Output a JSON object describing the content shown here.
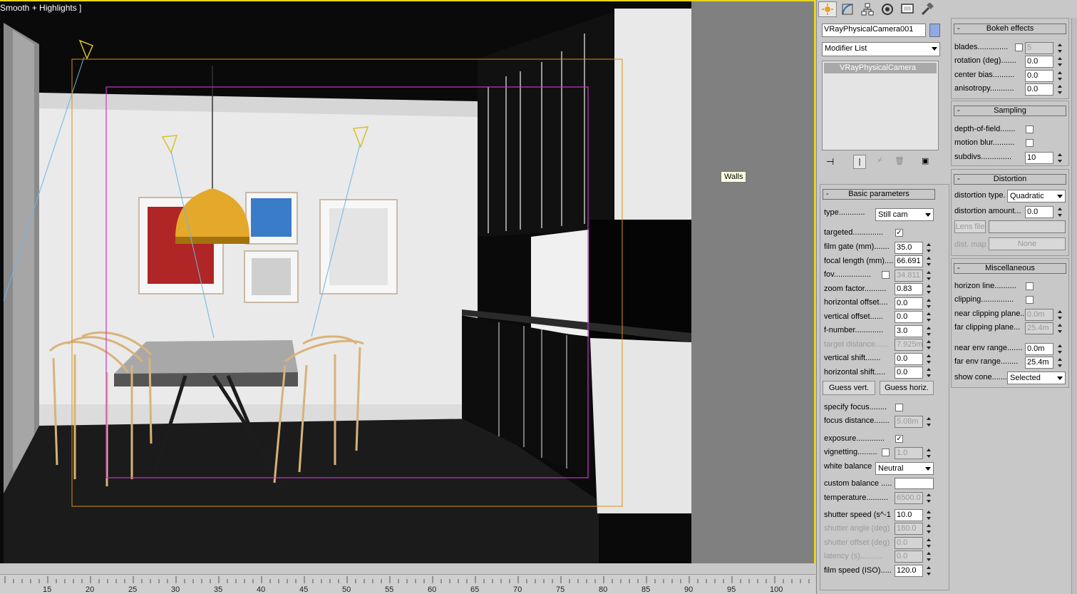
{
  "viewport": {
    "label": "Smooth + Highlights ]",
    "tooltip": "Walls"
  },
  "ruler": {
    "ticks": [
      "15",
      "20",
      "25",
      "30",
      "35",
      "40",
      "45",
      "50",
      "55",
      "60",
      "65",
      "70",
      "75",
      "80",
      "85",
      "90",
      "95",
      "100"
    ]
  },
  "command_panel": {
    "tabs": [
      "create-icon",
      "modify-icon",
      "hierarchy-icon",
      "motion-icon",
      "display-icon",
      "utilities-icon"
    ],
    "object_name": "VRayPhysicalCamera001",
    "object_color": "#8fa8e6",
    "modifier_list": "Modifier List",
    "stack_item": "VRayPhysicalCamera"
  },
  "basic": {
    "title": "Basic parameters",
    "type_label": "type............",
    "type_value": "Still cam",
    "targeted": "targeted..............",
    "film_gate": "film gate (mm).......",
    "film_gate_v": "35.0",
    "focal_length": "focal length (mm)....",
    "focal_length_v": "66.691",
    "fov": "fov.................",
    "fov_v": "34.811",
    "zoom": "zoom factor..........",
    "zoom_v": "0.83",
    "hoff": "horizontal offset....",
    "hoff_v": "0.0",
    "voff": "vertical offset......",
    "voff_v": "0.0",
    "fnum": "f-number.............",
    "fnum_v": "3.0",
    "tdist": "target distance......",
    "tdist_v": "7.925m",
    "vshift": "vertical shift.......",
    "vshift_v": "0.0",
    "hshift": "horizontal shift.....",
    "hshift_v": "0.0",
    "guess_vert": "Guess vert.",
    "guess_horiz": "Guess horiz.",
    "spec_focus": "specify focus........",
    "focus_dist": "focus distance.......",
    "focus_dist_v": "5.08m",
    "exposure": "exposure.............",
    "vignetting": "vignetting.........",
    "vignetting_v": "1.0",
    "wb": "white balance",
    "wb_v": "Neutral",
    "custom_bal": "custom balance .....",
    "temperature": "temperature..........",
    "temperature_v": "6500.0",
    "shutter": "shutter speed (s^-1",
    "shutter_v": "10.0",
    "shutter_angle": "shutter angle (deg)",
    "shutter_angle_v": "180.0",
    "shutter_offset": "shutter offset (deg)",
    "shutter_offset_v": "0.0",
    "latency": "latency (s)..........",
    "latency_v": "0.0",
    "iso": "film speed (ISO).....",
    "iso_v": "120.0"
  },
  "bokeh": {
    "title": "Bokeh effects",
    "blades": "blades..............",
    "blades_v": "5",
    "rotation": "rotation (deg).......",
    "rotation_v": "0.0",
    "center_bias": "center bias..........",
    "center_bias_v": "0.0",
    "anisotropy": "anisotropy...........",
    "anisotropy_v": "0.0"
  },
  "sampling": {
    "title": "Sampling",
    "dof": "depth-of-field.......",
    "motion_blur": "motion blur..........",
    "subdivs": "subdivs..............",
    "subdivs_v": "10"
  },
  "distortion": {
    "title": "Distortion",
    "type": "distortion type.",
    "type_v": "Quadratic",
    "amount": "distortion amount...",
    "amount_v": "0.0",
    "lens_file": "Lens file",
    "dist_map": "dist. map",
    "none": "None"
  },
  "misc": {
    "title": "Miscellaneous",
    "horizon": "horizon line..........",
    "clipping": "clipping...............",
    "near_clip": "near clipping plane..",
    "near_clip_v": "0.0m",
    "far_clip": "far clipping plane...",
    "far_clip_v": "25.4m",
    "near_env": "near env range.......",
    "near_env_v": "0.0m",
    "far_env": "far env range........",
    "far_env_v": "25.4m",
    "show_cone": "show cone.......",
    "show_cone_v": "Selected"
  }
}
